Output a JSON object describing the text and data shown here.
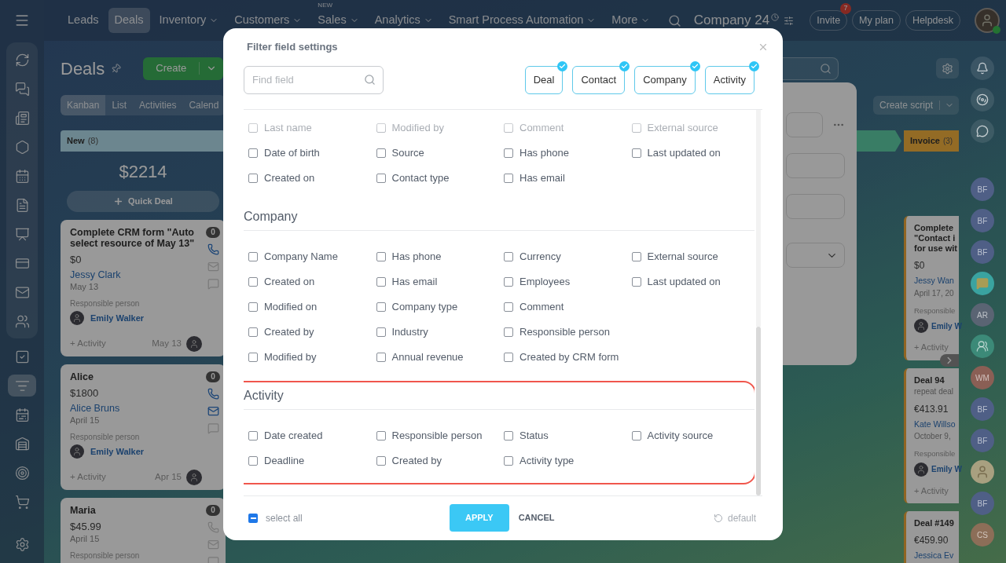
{
  "top_bar": {
    "nav": [
      {
        "label": "Leads",
        "selected": false,
        "dropdown": false
      },
      {
        "label": "Deals",
        "selected": true,
        "dropdown": false
      },
      {
        "label": "Inventory",
        "selected": false,
        "dropdown": true
      },
      {
        "label": "Customers",
        "selected": false,
        "dropdown": true
      },
      {
        "label": "Sales",
        "selected": false,
        "dropdown": true,
        "tag": "NEW"
      },
      {
        "label": "Analytics",
        "selected": false,
        "dropdown": true
      },
      {
        "label": "Smart Process Automation",
        "selected": false,
        "dropdown": true
      },
      {
        "label": "More",
        "selected": false,
        "dropdown": true
      }
    ],
    "company": "Company 24",
    "buttons": [
      {
        "label": "Invite",
        "badge": "7"
      },
      {
        "label": "My plan"
      },
      {
        "label": "Helpdesk"
      }
    ]
  },
  "left_rail": [
    {
      "items": [
        {
          "selected": false
        },
        {
          "selected": false
        },
        {
          "selected": false
        },
        {
          "selected": false
        },
        {
          "selected": false
        },
        {
          "selected": false
        },
        {
          "selected": false
        },
        {
          "selected": false
        },
        {
          "selected": false
        },
        {
          "selected": false
        }
      ]
    },
    {
      "items": [
        {
          "selected": false
        },
        {
          "selected": true
        },
        {
          "selected": false
        },
        {
          "selected": false
        },
        {
          "selected": false
        },
        {
          "selected": false
        }
      ]
    },
    {
      "items": [
        {
          "selected": false
        }
      ]
    }
  ],
  "page": {
    "title": "Deals",
    "create": "Create",
    "create_script": "Create script",
    "views": [
      {
        "label": "Kanban",
        "selected": true
      },
      {
        "label": "List",
        "selected": false
      },
      {
        "label": "Activities",
        "selected": false
      },
      {
        "label": "Calend",
        "selected": false
      }
    ]
  },
  "columns": [
    {
      "title": "New",
      "count": "(8)",
      "total": "$2214",
      "quick_deal": "Quick Deal",
      "cards": [
        {
          "title": "Complete CRM form \"Auto select resource of May 13\"",
          "amount": "$0",
          "contact": "Jessy Clark",
          "date": "May 13",
          "responsible_label": "Responsible person",
          "responsible": "Emily Walker",
          "activity": "+ Activity",
          "activity_date": "May 13",
          "counter": "0",
          "phone": true,
          "mail": false
        },
        {
          "title": "Alice",
          "amount": "$1800",
          "contact": "Alice Bruns",
          "date": "April 15",
          "responsible_label": "Responsible person",
          "responsible": "Emily Walker",
          "activity": "+ Activity",
          "activity_date": "Apr 15",
          "counter": "0",
          "phone": true,
          "mail": true
        },
        {
          "title": "Maria",
          "amount": "$45.99",
          "date": "April 15",
          "responsible_label": "Responsible person",
          "counter": "0",
          "phone": false,
          "mail": false
        }
      ]
    },
    {
      "title": "Invoice",
      "count": "(3)",
      "cards": [
        {
          "title_lines": [
            "Complete",
            "\"Contact i",
            "for use wit"
          ],
          "amount": "$0",
          "contact": "Jessy Wan",
          "date": "April 17, 20",
          "responsible_label": "Responsible",
          "responsible": "Emily W",
          "activity": "+ Activity"
        },
        {
          "title_lines": [
            "Deal 94"
          ],
          "subtitle": "repeat deal",
          "amount": "€413.91",
          "contact": "Kate Willso",
          "date": "October 9,",
          "responsible_label": "Responsible",
          "responsible": "Emily W",
          "activity": "+ Activity"
        },
        {
          "title_lines": [
            "Deal #149"
          ],
          "amount": "€459.90",
          "contact": "Jessica Ev"
        }
      ]
    }
  ],
  "right_rail": [
    {
      "kind": "bell"
    },
    {
      "kind": "swirl"
    },
    {
      "kind": "chat"
    },
    {
      "kind": "initials",
      "initials": "BF",
      "color": "#4f5f86"
    },
    {
      "kind": "initials",
      "initials": "BF",
      "color": "#4f5f86"
    },
    {
      "kind": "initials",
      "initials": "BF",
      "color": "#4f5f86"
    },
    {
      "kind": "chat-group",
      "color": "#3aa3a0"
    },
    {
      "kind": "initials",
      "initials": "AR",
      "color": "#5a6473"
    },
    {
      "kind": "people",
      "color": "#3c8a78"
    },
    {
      "kind": "initials",
      "initials": "WM",
      "color": "#8a5f55"
    },
    {
      "kind": "initials",
      "initials": "BF",
      "color": "#4f5f86"
    },
    {
      "kind": "initials",
      "initials": "BF",
      "color": "#4f5f86"
    },
    {
      "kind": "photo",
      "color": "#a8a080"
    },
    {
      "kind": "initials",
      "initials": "BF",
      "color": "#4f5f86"
    },
    {
      "kind": "initials",
      "initials": "CS",
      "color": "#8c6e58"
    }
  ],
  "filter_dialog": {
    "title": "Filter field settings",
    "search": {
      "placeholder": "Find field"
    },
    "entities": [
      {
        "label": "Deal",
        "selected": true
      },
      {
        "label": "Contact",
        "selected": true
      },
      {
        "label": "Company",
        "selected": true
      },
      {
        "label": "Activity",
        "selected": true
      }
    ],
    "sections": [
      {
        "annotated": false,
        "columns": [
          [
            {
              "label": "Last name",
              "checked": false
            },
            {
              "label": "Date of birth",
              "checked": false
            },
            {
              "label": "Created on",
              "checked": false
            }
          ],
          [
            {
              "label": "Modified by",
              "checked": false
            },
            {
              "label": "Source",
              "checked": false
            },
            {
              "label": "Contact type",
              "checked": false
            }
          ],
          [
            {
              "label": "Comment",
              "checked": false
            },
            {
              "label": "Has phone",
              "checked": false
            },
            {
              "label": "Has email",
              "checked": false
            }
          ],
          [
            {
              "label": "External source",
              "checked": false
            },
            {
              "label": "Last updated on",
              "checked": false
            }
          ]
        ]
      },
      {
        "title": "Company",
        "annotated": false,
        "columns": [
          [
            {
              "label": "Company Name",
              "checked": false
            },
            {
              "label": "Created on",
              "checked": false
            },
            {
              "label": "Modified on",
              "checked": false
            },
            {
              "label": "Created by",
              "checked": false
            },
            {
              "label": "Modified by",
              "checked": false
            }
          ],
          [
            {
              "label": "Has phone",
              "checked": false
            },
            {
              "label": "Has email",
              "checked": false
            },
            {
              "label": "Company type",
              "checked": false
            },
            {
              "label": "Industry",
              "checked": false
            },
            {
              "label": "Annual revenue",
              "checked": false
            }
          ],
          [
            {
              "label": "Currency",
              "checked": false
            },
            {
              "label": "Employees",
              "checked": false
            },
            {
              "label": "Comment",
              "checked": false
            },
            {
              "label": "Responsible person",
              "checked": false
            },
            {
              "label": "Created by CRM form",
              "checked": false
            }
          ],
          [
            {
              "label": "External source",
              "checked": false
            },
            {
              "label": "Last updated on",
              "checked": false
            }
          ]
        ]
      },
      {
        "title": "Activity",
        "annotated": true,
        "columns": [
          [
            {
              "label": "Date created",
              "checked": false
            },
            {
              "label": "Deadline",
              "checked": false
            }
          ],
          [
            {
              "label": "Responsible person",
              "checked": false
            },
            {
              "label": "Created by",
              "checked": false
            }
          ],
          [
            {
              "label": "Status",
              "checked": false
            },
            {
              "label": "Activity type",
              "checked": false
            }
          ],
          [
            {
              "label": "Activity source",
              "checked": false
            }
          ]
        ]
      }
    ],
    "select_all": {
      "label": "select all",
      "indeterminate": true
    },
    "apply": "APPLY",
    "cancel": "CANCEL",
    "default": "default"
  }
}
